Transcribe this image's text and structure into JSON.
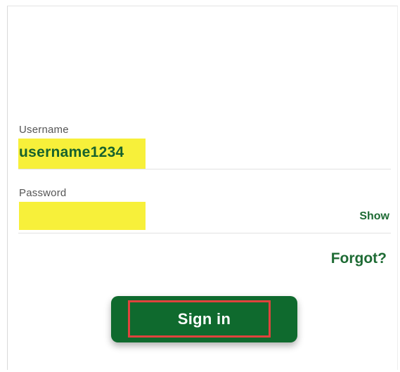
{
  "form": {
    "username_label": "Username",
    "username_value": "username1234",
    "password_label": "Password",
    "password_value": "",
    "show_label": "Show",
    "forgot_label": "Forgot?",
    "signin_label": "Sign in"
  },
  "colors": {
    "brand_green": "#0f6a2e",
    "highlight_yellow": "#f7f03a",
    "annotation_red": "#e0433d"
  }
}
